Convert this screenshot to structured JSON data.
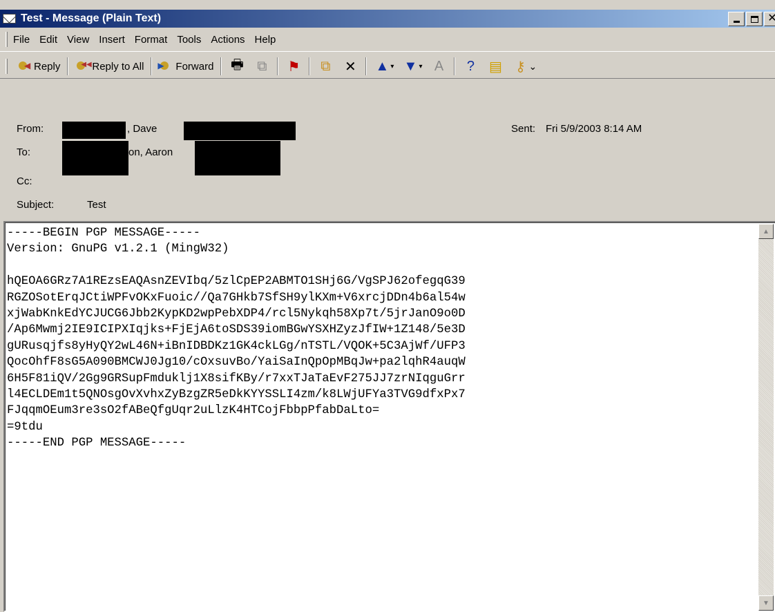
{
  "window": {
    "title": "Test - Message (Plain Text)"
  },
  "menu": [
    "File",
    "Edit",
    "View",
    "Insert",
    "Format",
    "Tools",
    "Actions",
    "Help"
  ],
  "toolbar": {
    "reply": "Reply",
    "reply_all": "Reply to All",
    "forward": "Forward"
  },
  "header": {
    "from_label": "From:",
    "from_value": ", Dave",
    "to_label": "To:",
    "to_value": "on, Aaron",
    "cc_label": "Cc:",
    "subject_label": "Subject:",
    "subject_value": "Test",
    "sent_label": "Sent:",
    "sent_value": "Fri 5/9/2003 8:14 AM"
  },
  "message": {
    "lines": [
      "-----BEGIN PGP MESSAGE-----",
      "Version: GnuPG v1.2.1 (MingW32)",
      "",
      "hQEOA6GRz7A1REzsEAQAsnZEVIbq/5zlCpEP2ABMTO1SHj6G/VgSPJ62ofegqG39",
      "RGZOSotErqJCtiWPFvOKxFuoic//Qa7GHkb7SfSH9ylKXm+V6xrcjDDn4b6al54w",
      "xjWabKnkEdYCJUCG6Jbb2KypKD2wpPebXDP4/rcl5Nykqh58Xp7t/5jrJanO9o0D",
      "/Ap6Mwmj2IE9ICIPXIqjks+FjEjA6toSDS39iomBGwYSXHZyzJfIW+1Z148/5e3D",
      "gURusqjfs8yHyQY2wL46N+iBnIDBDKz1GK4ckLGg/nTSTL/VQOK+5C3AjWf/UFP3",
      "QocOhfF8sG5A090BMCWJ0Jg10/cOxsuvBo/YaiSaInQpOpMBqJw+pa2lqhR4auqW",
      "6H5F81iQV/2Gg9GRSupFmduklj1X8sifKBy/r7xxTJaTaEvF275JJ7zrNIqguGrr",
      "l4ECLDEm1t5QNOsgOvXvhxZyBzgZR5eDkKYYSSLI4zm/k8LWjUFYa3TVG9dfxPx7",
      "FJqqmOEum3re3sO2fABeQfgUqr2uLlzK4HTCojFbbpPfabDaLto=",
      "=9tdu",
      "-----END PGP MESSAGE-----"
    ]
  }
}
